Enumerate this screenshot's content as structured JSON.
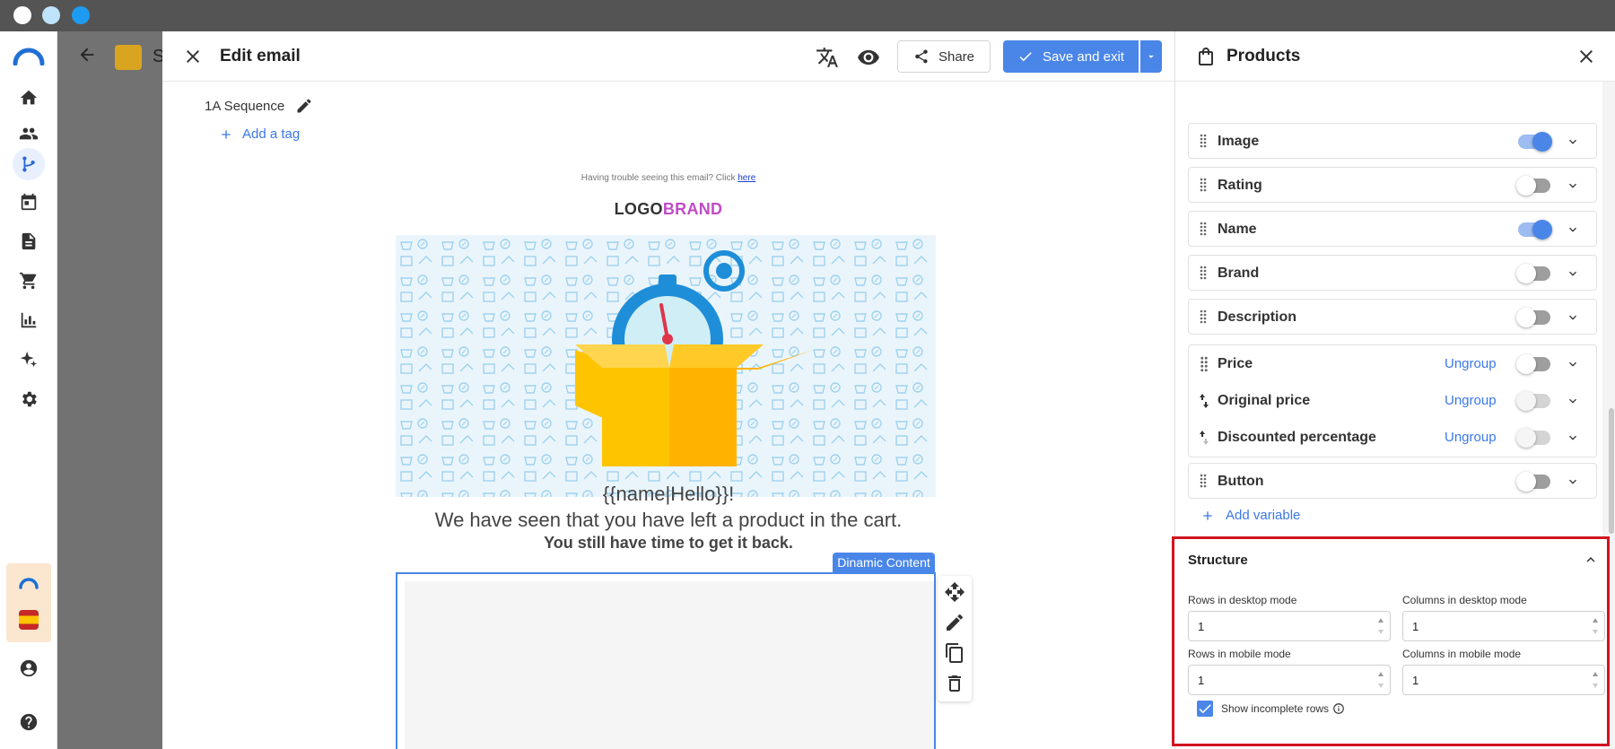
{
  "editor": {
    "title": "Edit email",
    "share_label": "Share",
    "save_label": "Save and exit",
    "sequence_label": "1A Sequence",
    "add_tag_label": "Add a tag"
  },
  "background": {
    "partial_title": "S"
  },
  "email": {
    "trouble_text": "Having trouble seeing this email? Click ",
    "trouble_link": "here",
    "logo_part1": "LOGO",
    "logo_part2": "BRAND",
    "greeting": "{{name|Hello}}!",
    "message": "We have seen that you have left a product in the cart.",
    "subline": "You still have time to get it back.",
    "dynamic_tag": "Dinamic Content"
  },
  "products_panel": {
    "title": "Products",
    "ungroup_label": "Ungroup",
    "add_variable_label": "Add variable",
    "rows": [
      {
        "label": "Image",
        "enabled": true
      },
      {
        "label": "Rating",
        "enabled": false
      },
      {
        "label": "Name",
        "enabled": true
      },
      {
        "label": "Brand",
        "enabled": false
      },
      {
        "label": "Description",
        "enabled": false
      }
    ],
    "price_group": [
      {
        "label": "Price",
        "enabled": false
      },
      {
        "label": "Original price",
        "enabled": false
      },
      {
        "label": "Discounted percentage",
        "enabled": false
      }
    ],
    "button_row": {
      "label": "Button",
      "enabled": false
    }
  },
  "structure": {
    "title": "Structure",
    "rows_desktop_label": "Rows in desktop mode",
    "rows_desktop_value": "1",
    "cols_desktop_label": "Columns in desktop mode",
    "cols_desktop_value": "1",
    "rows_mobile_label": "Rows in mobile mode",
    "rows_mobile_value": "1",
    "cols_mobile_label": "Columns in mobile mode",
    "cols_mobile_value": "1",
    "show_incomplete_label": "Show incomplete rows",
    "show_incomplete_checked": true
  },
  "colors": {
    "accent": "#4a86e8",
    "highlight_border": "#d0141f",
    "brand_pink": "#c04bc6"
  }
}
